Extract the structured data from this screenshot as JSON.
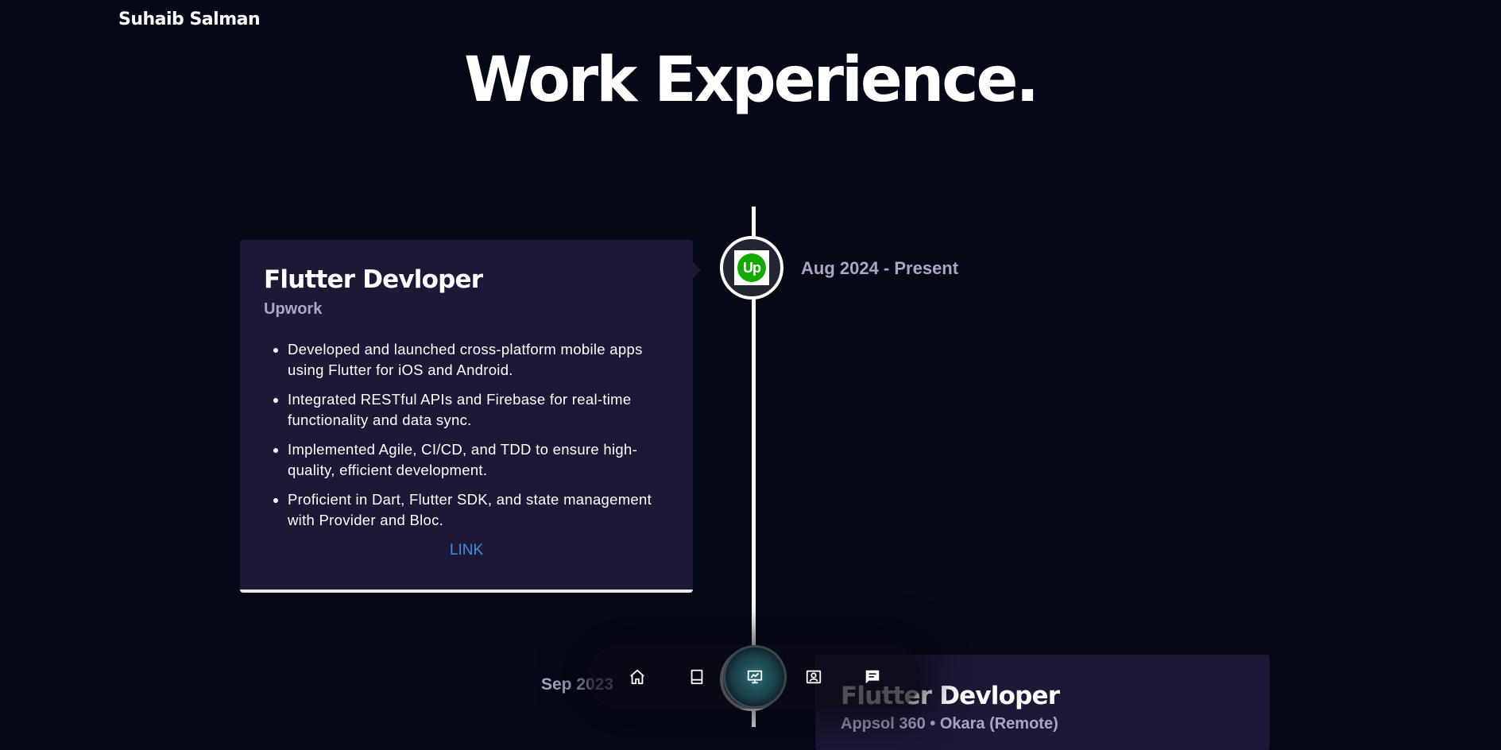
{
  "header": {
    "brand": "Suhaib Salman"
  },
  "page": {
    "title": "Work Experience."
  },
  "experiences": [
    {
      "date": "Aug 2024 - Present",
      "title": "Flutter Devloper",
      "company": "Upwork",
      "logo_text": "Up",
      "points": [
        "Developed and launched cross-platform mobile apps using Flutter for iOS and Android.",
        "Integrated RESTful APIs and Firebase for real-time functionality and data sync.",
        "Implemented Agile, CI/CD, and TDD to ensure high-quality, efficient development.",
        "Proficient in Dart, Flutter SDK, and state management with Provider and Bloc."
      ],
      "link_label": "LINK"
    },
    {
      "date": "Sep 2023",
      "title": "Flutter Devloper",
      "company": "Appsol 360 • Okara (Remote)"
    }
  ],
  "dock": {
    "items": [
      {
        "icon": "home-icon"
      },
      {
        "icon": "book-icon"
      },
      {
        "icon": "presentation-chart-icon",
        "active": true
      },
      {
        "icon": "contact-card-icon"
      },
      {
        "icon": "chat-icon"
      }
    ]
  },
  "colors": {
    "background": "#050816",
    "card": "#1d1836",
    "secondary_text": "#aaa6c3",
    "link": "#3f8fd9",
    "upwork_green": "#14a800"
  }
}
